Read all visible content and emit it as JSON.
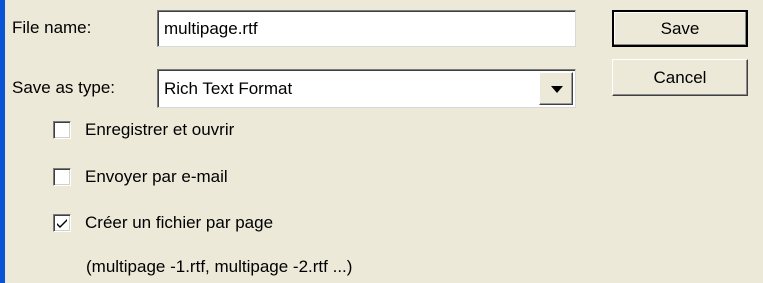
{
  "dialog": {
    "file_name_label": "File name:",
    "file_name_value": "multipage.rtf",
    "save_as_type_label": "Save as type:",
    "save_as_type_value": "Rich Text Format",
    "save_button": "Save",
    "cancel_button": "Cancel"
  },
  "options": [
    {
      "label": "Enregistrer et ouvrir",
      "checked": false
    },
    {
      "label": "Envoyer par e-mail",
      "checked": false
    },
    {
      "label": "Créer un fichier par page",
      "checked": true
    }
  ],
  "hint": "(multipage -1.rtf, multipage -2.rtf ...)",
  "icons": {
    "dropdown": "chevron-down-icon",
    "check": "checkmark-icon"
  },
  "colors": {
    "background": "#ece9d8",
    "accent": "#0a55d6"
  }
}
